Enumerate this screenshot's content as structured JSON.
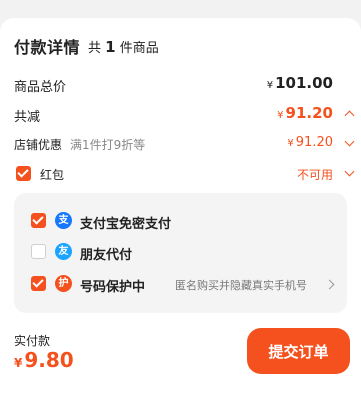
{
  "header": {
    "title": "付款详情",
    "count_prefix": "共",
    "count": "1",
    "count_suffix": "件商品"
  },
  "summary": {
    "total_label": "商品总价",
    "total_currency": "¥",
    "total_value": "101.00",
    "discount_label": "共减",
    "discount_currency": "¥",
    "discount_value": "91.20",
    "store_label": "店铺优惠",
    "store_desc": "满1件打9折等",
    "store_currency": "¥",
    "store_value": "91.20",
    "redpacket_label": "红包",
    "redpacket_value": "不可用"
  },
  "payment_options": [
    {
      "label": "支付宝免密支付",
      "checked": true,
      "icon": "alipay-icon",
      "icon_glyph": "支",
      "icon_color": "#1677ff"
    },
    {
      "label": "朋友代付",
      "checked": false,
      "icon": "friend-pay-icon",
      "icon_glyph": "友",
      "icon_color": "#1aa3ff"
    },
    {
      "label": "号码保护中",
      "checked": true,
      "icon": "number-protect-icon",
      "icon_glyph": "护",
      "icon_color": "#f4511e",
      "note": "匿名购买并隐藏真实手机号"
    }
  ],
  "footer": {
    "actual_label": "实付款",
    "actual_currency": "¥",
    "actual_value": "9.80",
    "submit_label": "提交订单"
  },
  "colors": {
    "accent": "#f4511e",
    "page_bg": "#f2f2f2",
    "panel_bg": "#f4f4f4"
  }
}
